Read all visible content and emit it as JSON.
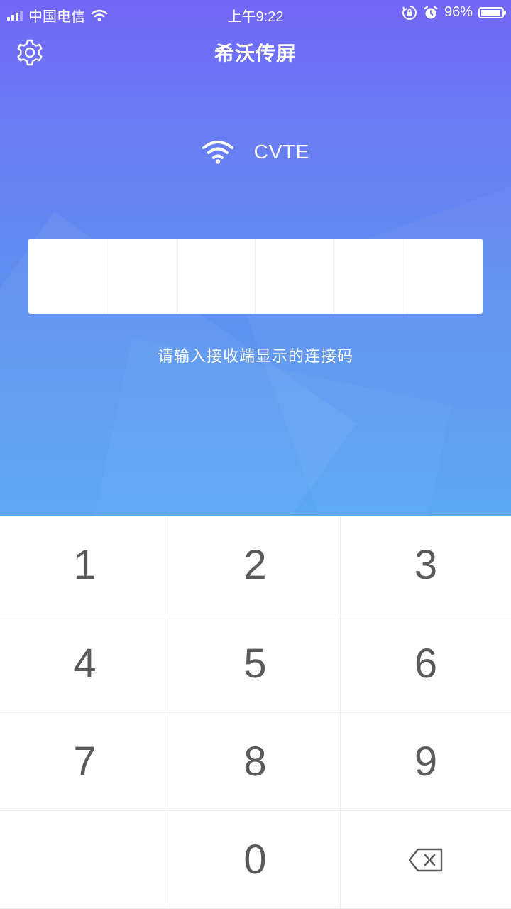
{
  "status_bar": {
    "carrier": "中国电信",
    "time": "上午9:22",
    "battery_percent": "96%",
    "battery_level": 0.96
  },
  "header": {
    "title": "希沃传屏",
    "settings_icon": "gear-icon"
  },
  "network": {
    "icon": "wifi-icon",
    "name": "CVTE"
  },
  "code_input": {
    "cells": [
      "",
      "",
      "",
      "",
      "",
      ""
    ]
  },
  "hint": "请输入接收端显示的连接码",
  "keypad": {
    "keys": [
      "1",
      "2",
      "3",
      "4",
      "5",
      "6",
      "7",
      "8",
      "9",
      "",
      "0"
    ],
    "backspace_icon": "backspace-icon"
  },
  "colors": {
    "gradient_top": "#7266f7",
    "gradient_bottom": "#56a5f4",
    "key_text": "#5a5a5a"
  }
}
